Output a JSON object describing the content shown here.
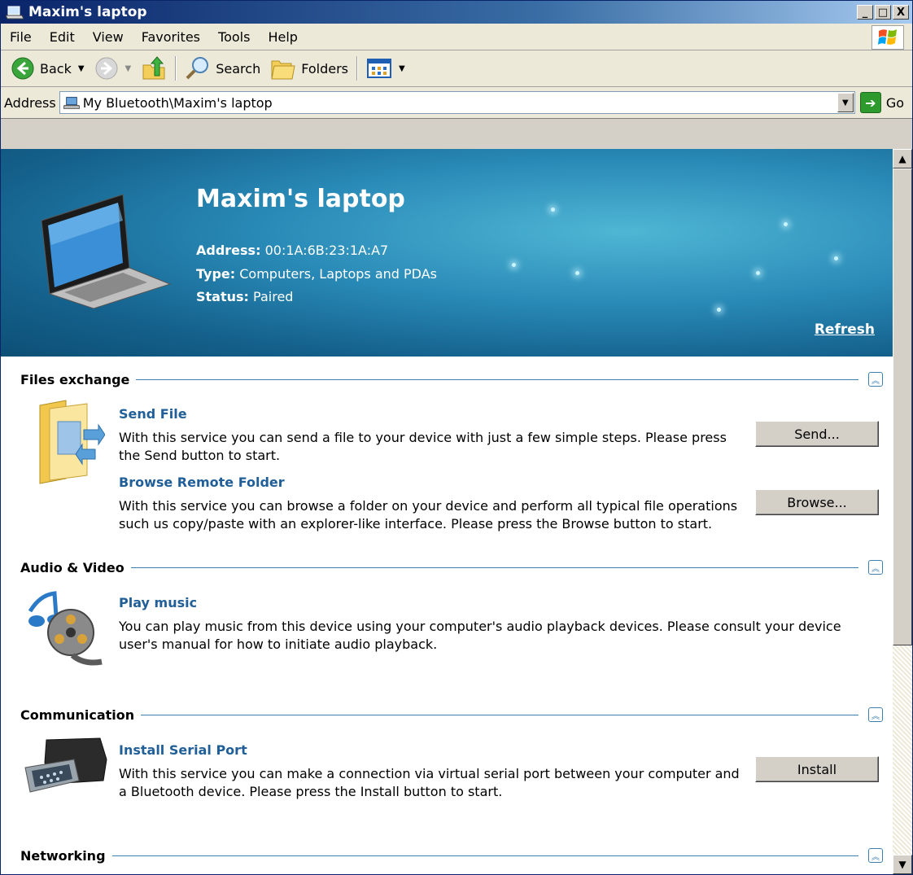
{
  "window": {
    "title": "Maxim's laptop",
    "caption_buttons": [
      "_",
      "□",
      "X"
    ]
  },
  "menu": [
    {
      "label": "File"
    },
    {
      "label": "Edit"
    },
    {
      "label": "View"
    },
    {
      "label": "Favorites"
    },
    {
      "label": "Tools"
    },
    {
      "label": "Help"
    }
  ],
  "toolbar": {
    "back_label": "Back",
    "search_label": "Search",
    "folders_label": "Folders"
  },
  "address": {
    "label": "Address",
    "value": "My Bluetooth\\Maxim's laptop",
    "go_label": "Go"
  },
  "device": {
    "name": "Maxim's laptop",
    "address_label": "Address:",
    "address_value": "00:1A:6B:23:1A:A7",
    "type_label": "Type:",
    "type_value": "Computers, Laptops and PDAs",
    "status_label": "Status:",
    "status_value": "Paired",
    "refresh_label": "Refresh"
  },
  "sections": {
    "files": {
      "title": "Files exchange",
      "send_title": "Send File",
      "send_desc": "With this service you can send a file to your device with just a few simple steps. Please press the Send button to start.",
      "send_button": "Send...",
      "browse_title": "Browse Remote Folder",
      "browse_desc": "With this service you can browse a folder on your device and perform all typical file operations such us copy/paste with an explorer-like interface. Please press the Browse button to start.",
      "browse_button": "Browse..."
    },
    "audio": {
      "title": "Audio & Video",
      "play_title": "Play music",
      "play_desc": "You can play music from this device using your computer's audio playback devices. Please consult your device user's manual for how to initiate audio playback."
    },
    "comm": {
      "title": "Communication",
      "serial_title": "Install Serial Port",
      "serial_desc": "With this service you can make a connection via virtual serial port between your computer and a Bluetooth device. Please press the Install button to start.",
      "serial_button": "Install"
    },
    "net": {
      "title": "Networking"
    }
  }
}
